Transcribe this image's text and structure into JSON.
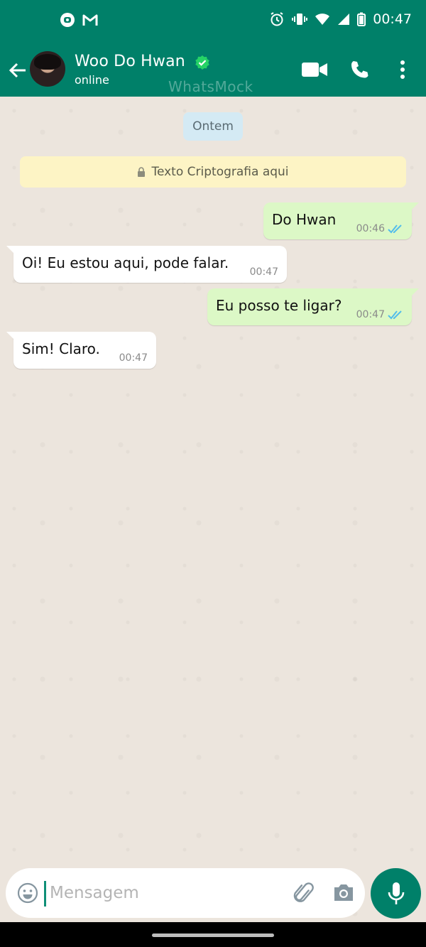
{
  "status_bar": {
    "time": "00:47",
    "left_icons": [
      "notification-app-icon",
      "gmail-icon"
    ],
    "right_icons": [
      "alarm-icon",
      "vibrate-icon",
      "wifi-icon",
      "signal-icon",
      "battery-icon"
    ]
  },
  "header": {
    "contact_name": "Woo Do Hwan",
    "verified": true,
    "presence": "online",
    "watermark": "WhatsMock",
    "actions": [
      "video-call-icon",
      "voice-call-icon",
      "more-options-icon"
    ]
  },
  "chat": {
    "date_chip": "Ontem",
    "encryption_notice": "Texto Criptografia aqui",
    "messages": [
      {
        "direction": "out",
        "text": "Do Hwan",
        "time": "00:46",
        "read": true
      },
      {
        "direction": "in",
        "text": "Oi! Eu estou aqui, pode falar.",
        "time": "00:47"
      },
      {
        "direction": "out",
        "text": "Eu posso te ligar?",
        "time": "00:47",
        "read": true
      },
      {
        "direction": "in",
        "text": "Sim! Claro.",
        "time": "00:47"
      }
    ]
  },
  "composer": {
    "placeholder": "Mensagem",
    "value": ""
  },
  "colors": {
    "header_bg": "#008069",
    "chat_bg": "#ece5dd",
    "outgoing_bubble": "#dcf8c6",
    "incoming_bubble": "#ffffff",
    "read_ticks": "#53bdeb"
  }
}
